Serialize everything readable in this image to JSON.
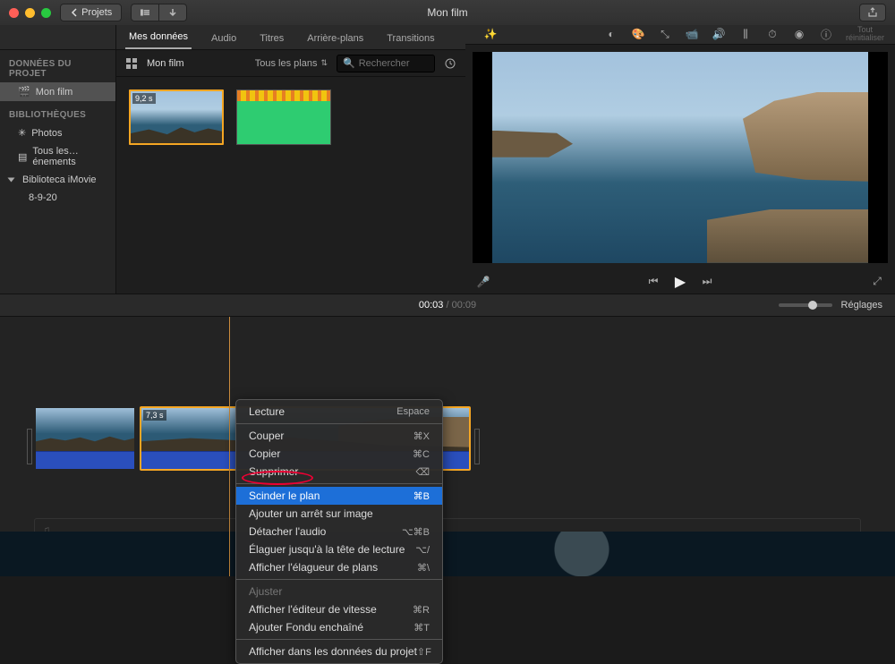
{
  "titlebar": {
    "back": "Projets",
    "title": "Mon film"
  },
  "sidebar": {
    "section_project": "DONNÉES DU PROJET",
    "project_name": "Mon film",
    "section_libraries": "BIBLIOTHÈQUES",
    "photos": "Photos",
    "all_events": "Tous les…énements",
    "library_name": "Biblioteca iMovie",
    "event_name": "8-9-20"
  },
  "media": {
    "tabs": [
      "Mes données",
      "Audio",
      "Titres",
      "Arrière-plans",
      "Transitions"
    ],
    "active_tab": 0,
    "file_name": "Mon film",
    "filter_label": "Tous les plans",
    "search_placeholder": "Rechercher",
    "clip_duration": "9,2 s"
  },
  "viewer": {
    "reset_line1": "Tout",
    "reset_line2": "réinitialiser"
  },
  "timeline": {
    "current": "00:03",
    "duration": "00:09",
    "settings": "Réglages",
    "clip2_duration": "7,3 s"
  },
  "context_menu": {
    "items": [
      {
        "label": "Lecture",
        "shortcut": "Espace",
        "type": "item"
      },
      {
        "type": "sep"
      },
      {
        "label": "Couper",
        "shortcut": "⌘X",
        "type": "item"
      },
      {
        "label": "Copier",
        "shortcut": "⌘C",
        "type": "item"
      },
      {
        "label": "Supprimer",
        "shortcut": "⌫",
        "type": "item"
      },
      {
        "type": "sep"
      },
      {
        "label": "Scinder le plan",
        "shortcut": "⌘B",
        "type": "item",
        "highlight": true
      },
      {
        "label": "Ajouter un arrêt sur image",
        "shortcut": "",
        "type": "item"
      },
      {
        "label": "Détacher l'audio",
        "shortcut": "⌥⌘B",
        "type": "item"
      },
      {
        "label": "Élaguer jusqu'à la tête de lecture",
        "shortcut": "⌥/",
        "type": "item"
      },
      {
        "label": "Afficher l'élagueur de plans",
        "shortcut": "⌘\\",
        "type": "item"
      },
      {
        "type": "sep"
      },
      {
        "label": "Ajuster",
        "shortcut": "",
        "type": "item",
        "dim": true
      },
      {
        "label": "Afficher l'éditeur de vitesse",
        "shortcut": "⌘R",
        "type": "item"
      },
      {
        "label": "Ajouter Fondu enchaîné",
        "shortcut": "⌘T",
        "type": "item"
      },
      {
        "type": "sep"
      },
      {
        "label": "Afficher dans les données du projet",
        "shortcut": "⇧F",
        "type": "item"
      }
    ]
  }
}
